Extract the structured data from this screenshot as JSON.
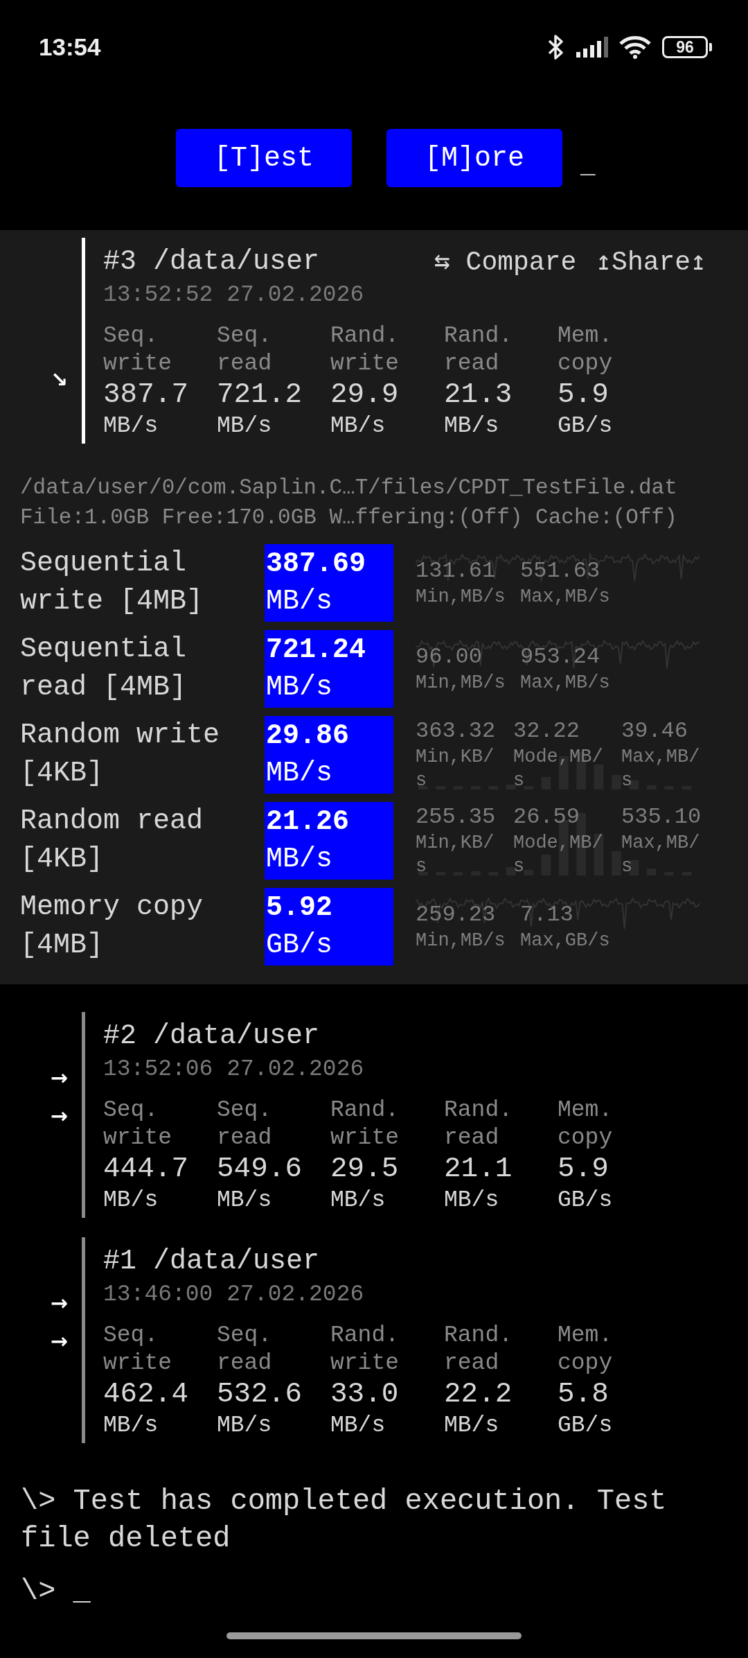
{
  "status_bar": {
    "time": "13:54",
    "battery": "96"
  },
  "buttons": [
    "[T]est",
    "[M]ore"
  ],
  "cursor": "_",
  "results": [
    {
      "title": "#3 /data/user",
      "date": "13:52:52 27.02.2026",
      "selected": true,
      "markers": [
        "↘"
      ],
      "compare": "⇆ Compare",
      "share": "↥Share↥",
      "metrics": [
        {
          "label": "Seq. write",
          "value": "387.7",
          "unit": "MB/s"
        },
        {
          "label": "Seq. read",
          "value": "721.2",
          "unit": "MB/s"
        },
        {
          "label": "Rand. write",
          "value": "29.9",
          "unit": "MB/s"
        },
        {
          "label": "Rand. read",
          "value": "21.3",
          "unit": "MB/s"
        },
        {
          "label": "Mem. copy",
          "value": "5.9",
          "unit": "GB/s"
        }
      ],
      "details": {
        "path": "/data/user/0/com.Saplin.C…T/files/CPDT_TestFile.dat",
        "info": "File:1.0GB Free:170.0GB W…ffering:(Off) Cache:(Off)",
        "rows": [
          {
            "label": "Sequential write [4MB]",
            "value": "387.69",
            "unit": "MB/s",
            "kind": "line",
            "stats": [
              {
                "value": "131.61",
                "label": "Min,MB/s"
              },
              {
                "value": "551.63",
                "label": "Max,MB/s"
              }
            ]
          },
          {
            "label": "Sequential read [4MB]",
            "value": "721.24",
            "unit": "MB/s",
            "kind": "line",
            "stats": [
              {
                "value": "96.00",
                "label": "Min,MB/s"
              },
              {
                "value": "953.24",
                "label": "Max,MB/s"
              }
            ]
          },
          {
            "label": "Random write [4KB]",
            "value": "29.86",
            "unit": "MB/s",
            "kind": "bars",
            "stats": [
              {
                "value": "363.32",
                "label": "Min,KB/s"
              },
              {
                "value": "32.22",
                "label": "Mode,MB/s"
              },
              {
                "value": "39.46",
                "label": "Max,MB/s"
              }
            ]
          },
          {
            "label": "Random read [4KB]",
            "value": "21.26",
            "unit": "MB/s",
            "kind": "bars",
            "stats": [
              {
                "value": "255.35",
                "label": "Min,KB/s"
              },
              {
                "value": "26.59",
                "label": "Mode,MB/s"
              },
              {
                "value": "535.10",
                "label": "Max,MB/s"
              }
            ]
          },
          {
            "label": "Memory copy [4MB]",
            "value": "5.92",
            "unit": "GB/s",
            "kind": "line",
            "stats": [
              {
                "value": "259.23",
                "label": "Min,MB/s"
              },
              {
                "value": "7.13",
                "label": "Max,GB/s"
              }
            ]
          }
        ]
      }
    },
    {
      "title": "#2 /data/user",
      "date": "13:52:06 27.02.2026",
      "selected": false,
      "markers": [
        "→",
        "→"
      ],
      "metrics": [
        {
          "label": "Seq. write",
          "value": "444.7",
          "unit": "MB/s"
        },
        {
          "label": "Seq. read",
          "value": "549.6",
          "unit": "MB/s"
        },
        {
          "label": "Rand. write",
          "value": "29.5",
          "unit": "MB/s"
        },
        {
          "label": "Rand. read",
          "value": "21.1",
          "unit": "MB/s"
        },
        {
          "label": "Mem. copy",
          "value": "5.9",
          "unit": "GB/s"
        }
      ]
    },
    {
      "title": "#1 /data/user",
      "date": "13:46:00 27.02.2026",
      "selected": false,
      "markers": [
        "→",
        "→"
      ],
      "metrics": [
        {
          "label": "Seq. write",
          "value": "462.4",
          "unit": "MB/s"
        },
        {
          "label": "Seq. read",
          "value": "532.6",
          "unit": "MB/s"
        },
        {
          "label": "Rand. write",
          "value": "33.0",
          "unit": "MB/s"
        },
        {
          "label": "Rand. read",
          "value": "22.2",
          "unit": "MB/s"
        },
        {
          "label": "Mem. copy",
          "value": "5.8",
          "unit": "GB/s"
        }
      ]
    }
  ],
  "message": "\\> Test has completed execution. Test file deleted",
  "prompt": {
    "symbol": "\\>",
    "cursor": "_"
  }
}
